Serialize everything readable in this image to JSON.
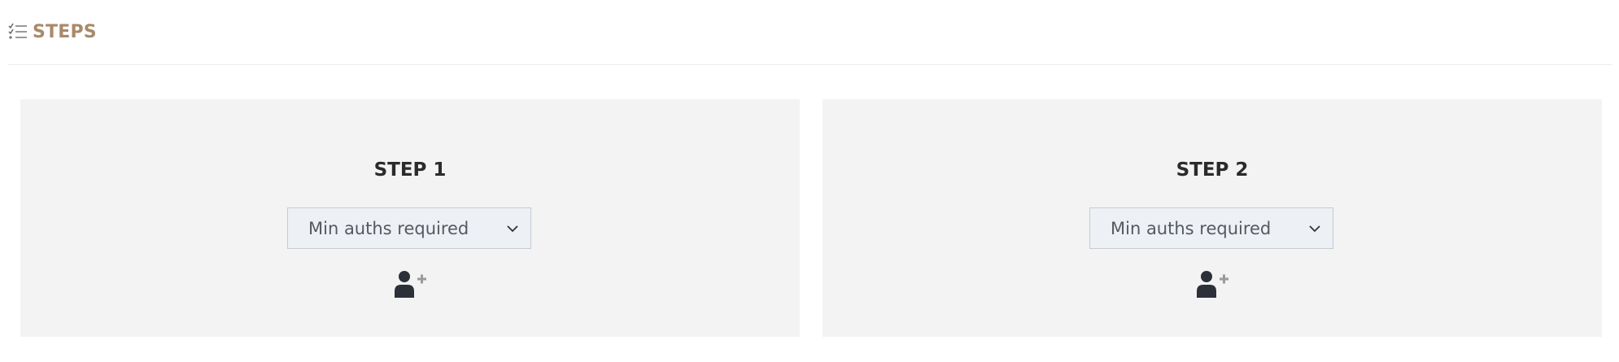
{
  "header": {
    "icon": "checklist-icon",
    "title": "STEPS"
  },
  "steps": [
    {
      "title": "STEP 1",
      "select": {
        "value": "Min auths required",
        "icon": "chevron-down-icon"
      },
      "add_icon": "add-user-icon"
    },
    {
      "title": "STEP 2",
      "select": {
        "value": "Min auths required",
        "icon": "chevron-down-icon"
      },
      "add_icon": "add-user-icon"
    }
  ],
  "colors": {
    "title_accent": "#a88a6a",
    "card_bg": "#f3f3f3",
    "select_bg": "#edf0f4",
    "user_icon": "#2c3038",
    "plus_icon": "#9a9a9a"
  }
}
